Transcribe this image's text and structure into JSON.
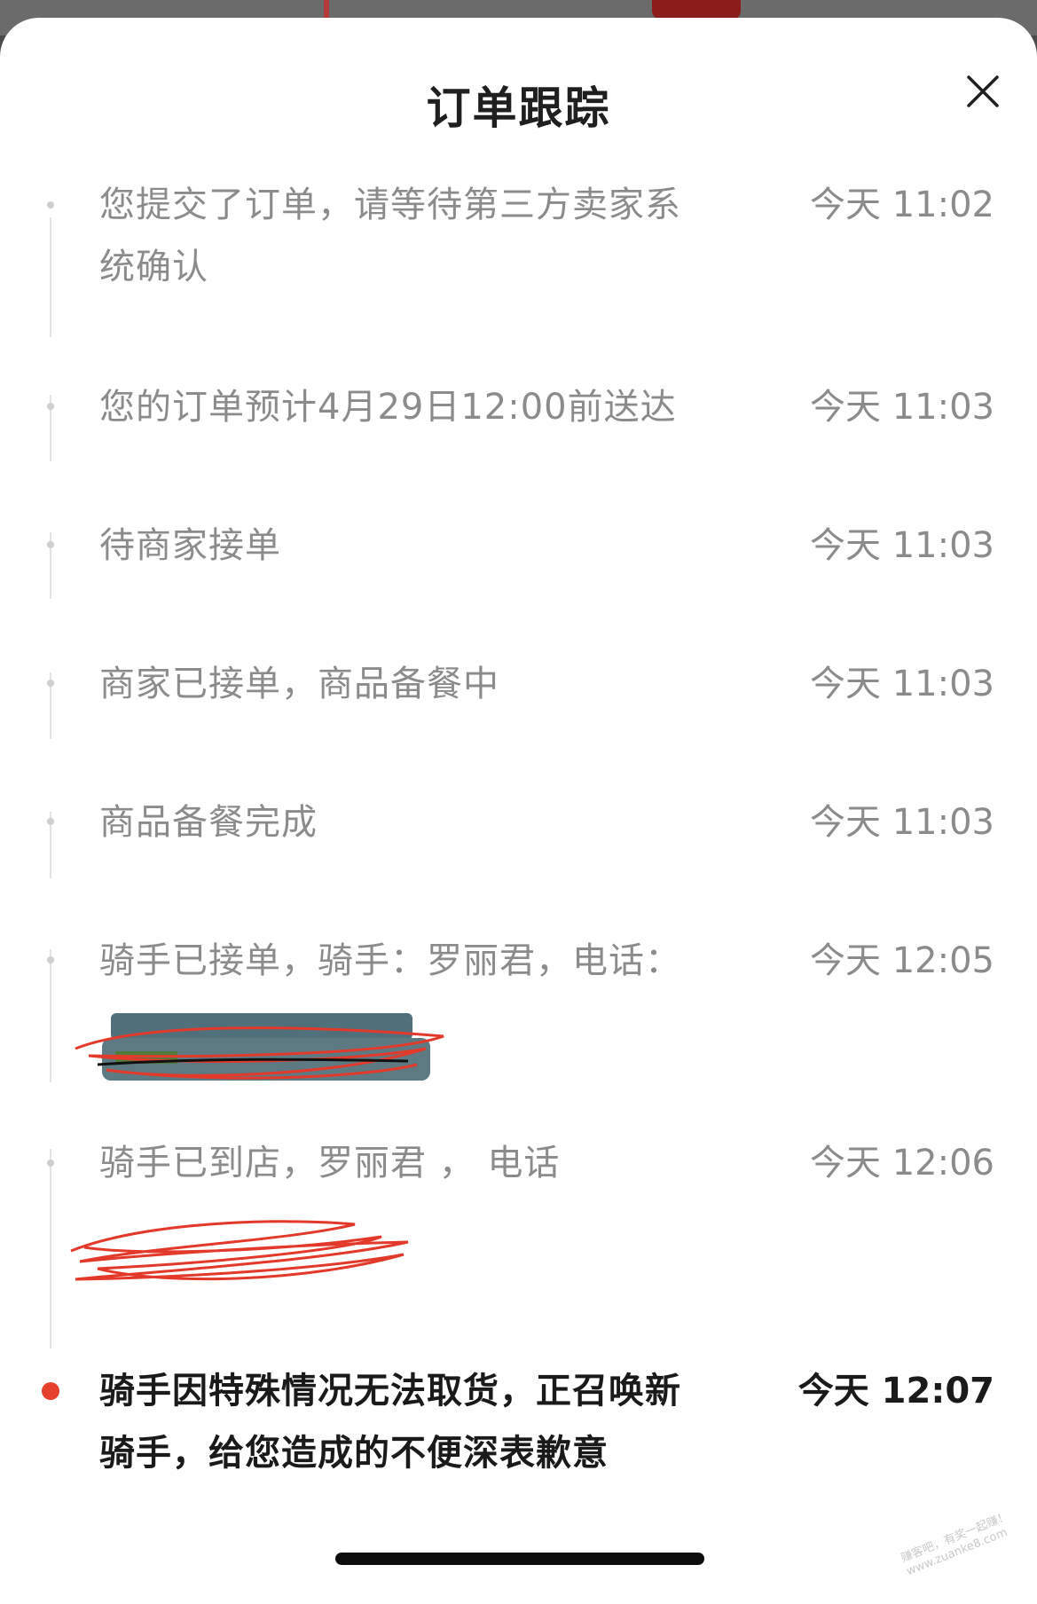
{
  "header": {
    "title": "订单跟踪",
    "close_icon": "close-icon"
  },
  "events": [
    {
      "text_line1": "您提交了订单，请等待第三方卖家系",
      "text_line2": "统确认",
      "time": "今天 11:02"
    },
    {
      "text": "您的订单预计4月29日12:00前送达",
      "time": "今天 11:03"
    },
    {
      "text": "待商家接单",
      "time": "今天 11:03"
    },
    {
      "text": "商家已接单，商品备餐中",
      "time": "今天 11:03"
    },
    {
      "text": "商品备餐完成",
      "time": "今天 11:03"
    },
    {
      "text": "骑手已接单，骑手：罗丽君，电话：",
      "time": "今天 12:05"
    },
    {
      "text": "骑手已到店，罗丽君 ，  电话",
      "time": "今天 12:06"
    },
    {
      "text_line1": "骑手因特殊情况无法取货，正召唤新",
      "text_line2": "骑手，给您造成的不便深表歉意",
      "time": "今天 12:07",
      "active": true
    }
  ],
  "colors": {
    "accent": "#e5412d",
    "muted_text": "#8b8b8b",
    "active_text": "#1a1a1a"
  },
  "watermark": {
    "line1": "赚客吧，有奖一起赚！",
    "line2": "www.zuanke8.com"
  }
}
